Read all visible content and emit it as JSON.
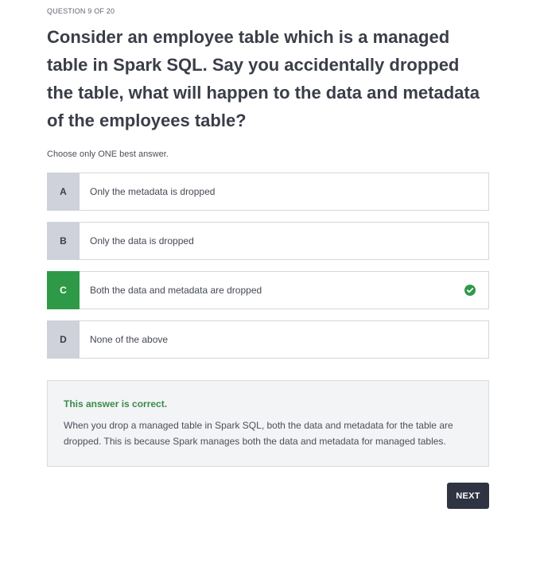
{
  "header": {
    "counter": "QUESTION 9 OF 20"
  },
  "question": {
    "text": "Consider an employee table which is a managed table in Spark SQL. Say you accidentally dropped the table, what will happen to the data and metadata of the employees table?",
    "instruction": "Choose only ONE best answer."
  },
  "options": [
    {
      "letter": "A",
      "text": "Only the metadata is dropped",
      "state": "default"
    },
    {
      "letter": "B",
      "text": "Only the data is dropped",
      "state": "default"
    },
    {
      "letter": "C",
      "text": "Both the data and metadata are dropped",
      "state": "correct"
    },
    {
      "letter": "D",
      "text": "None of the above",
      "state": "default"
    }
  ],
  "feedback": {
    "title": "This answer is correct.",
    "body": "When you drop a managed table in Spark SQL, both the data and metadata for the table are dropped. This is because Spark manages both the data and metadata for managed tables."
  },
  "actions": {
    "next_label": "NEXT"
  },
  "colors": {
    "correct": "#2e9a47",
    "letter_bg": "#cfd2da",
    "next_bg": "#2f3342",
    "feedback_title": "#3b8a4a"
  },
  "icons": {
    "correct_marker": "check-circle-icon"
  }
}
